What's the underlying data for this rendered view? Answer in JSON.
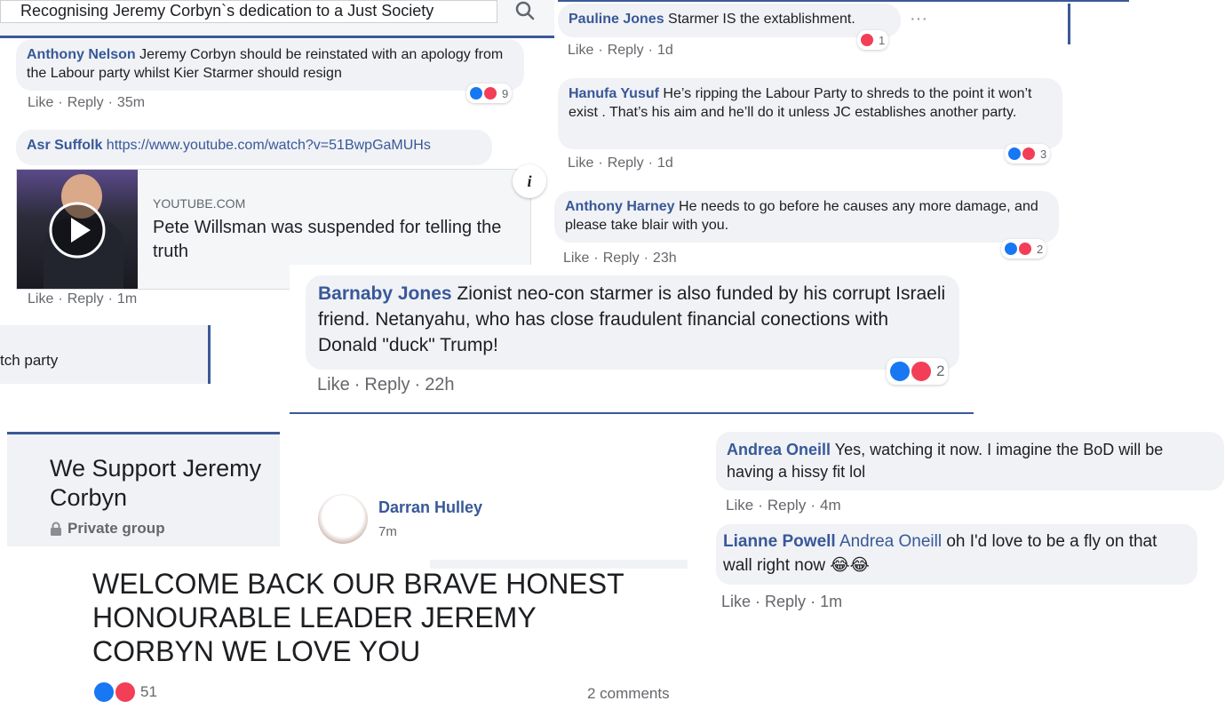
{
  "search": {
    "value": "Recognising Jeremy Corbyn`s dedication to a Just Society"
  },
  "comments": {
    "anthony_nelson": {
      "author": "Anthony Nelson",
      "text": "Jeremy Corbyn should be reinstated with an apology from the Labour party whilst Kier Starmer should resign",
      "like": "Like",
      "reply": "Reply",
      "time": "35m",
      "reactions": "9"
    },
    "asr_suffolk": {
      "author": "Asr Suffolk",
      "link": "https://www.youtube.com/watch?v=51BwpGaMUHs",
      "like": "Like",
      "reply": "Reply",
      "time": "1m"
    },
    "pauline_jones": {
      "author": "Pauline Jones",
      "text": "Starmer IS the extablishment.",
      "like": "Like",
      "reply": "Reply",
      "time": "1d",
      "reactions": "1",
      "more": "···"
    },
    "hanufa_yusuf": {
      "author": "Hanufa Yusuf",
      "text": "He’s ripping the Labour Party to shreds to the point it won’t exist . That’s his aim and he’ll do it unless JC establishes another party.",
      "like": "Like",
      "reply": "Reply",
      "time": "1d",
      "reactions": "3"
    },
    "anthony_harney": {
      "author": "Anthony Harney",
      "text": "He needs to go before he causes any more damage, and please take blair with you.",
      "like": "Like",
      "reply": "Reply",
      "time": "23h",
      "reactions": "2"
    },
    "barnaby_jones": {
      "author": "Barnaby Jones",
      "text": "Zionist neo-con starmer is also funded by his corrupt Israeli friend. Netanyahu, who has close fraudulent financial conections with Donald \"duck\" Trump!",
      "like": "Like",
      "reply": "Reply",
      "time": "22h",
      "reactions": "2"
    },
    "andrea_oneill": {
      "author": "Andrea Oneill",
      "text": "Yes, watching it now. I imagine the BoD will be having a hissy fit lol",
      "like": "Like",
      "reply": "Reply",
      "time": "4m"
    },
    "lianne_powell": {
      "author": "Lianne Powell",
      "mention": "Andrea Oneill",
      "text": "oh I'd love to be a fly on that wall right now",
      "emoji": "😂😂",
      "like": "Like",
      "reply": "Reply",
      "time": "1m"
    }
  },
  "youtube": {
    "domain": "YOUTUBE.COM",
    "title": "Pete Willsman was suspended for telling the truth",
    "info": "i"
  },
  "fragment": {
    "text": "tch party"
  },
  "group": {
    "name": "We Support Jeremy Corbyn",
    "privacy": "Private group"
  },
  "post": {
    "author": "Darran Hulley",
    "time": "7m",
    "text": "WELCOME BACK OUR BRAVE HONEST HONOURABLE LEADER JEREMY CORBYN WE LOVE YOU",
    "reactions": "51",
    "comments": "2 comments"
  },
  "colors": {
    "accent": "#385898",
    "bubble": "#f0f2f5",
    "like": "#1877f2",
    "love": "#f33e58",
    "meta": "#65676b"
  }
}
